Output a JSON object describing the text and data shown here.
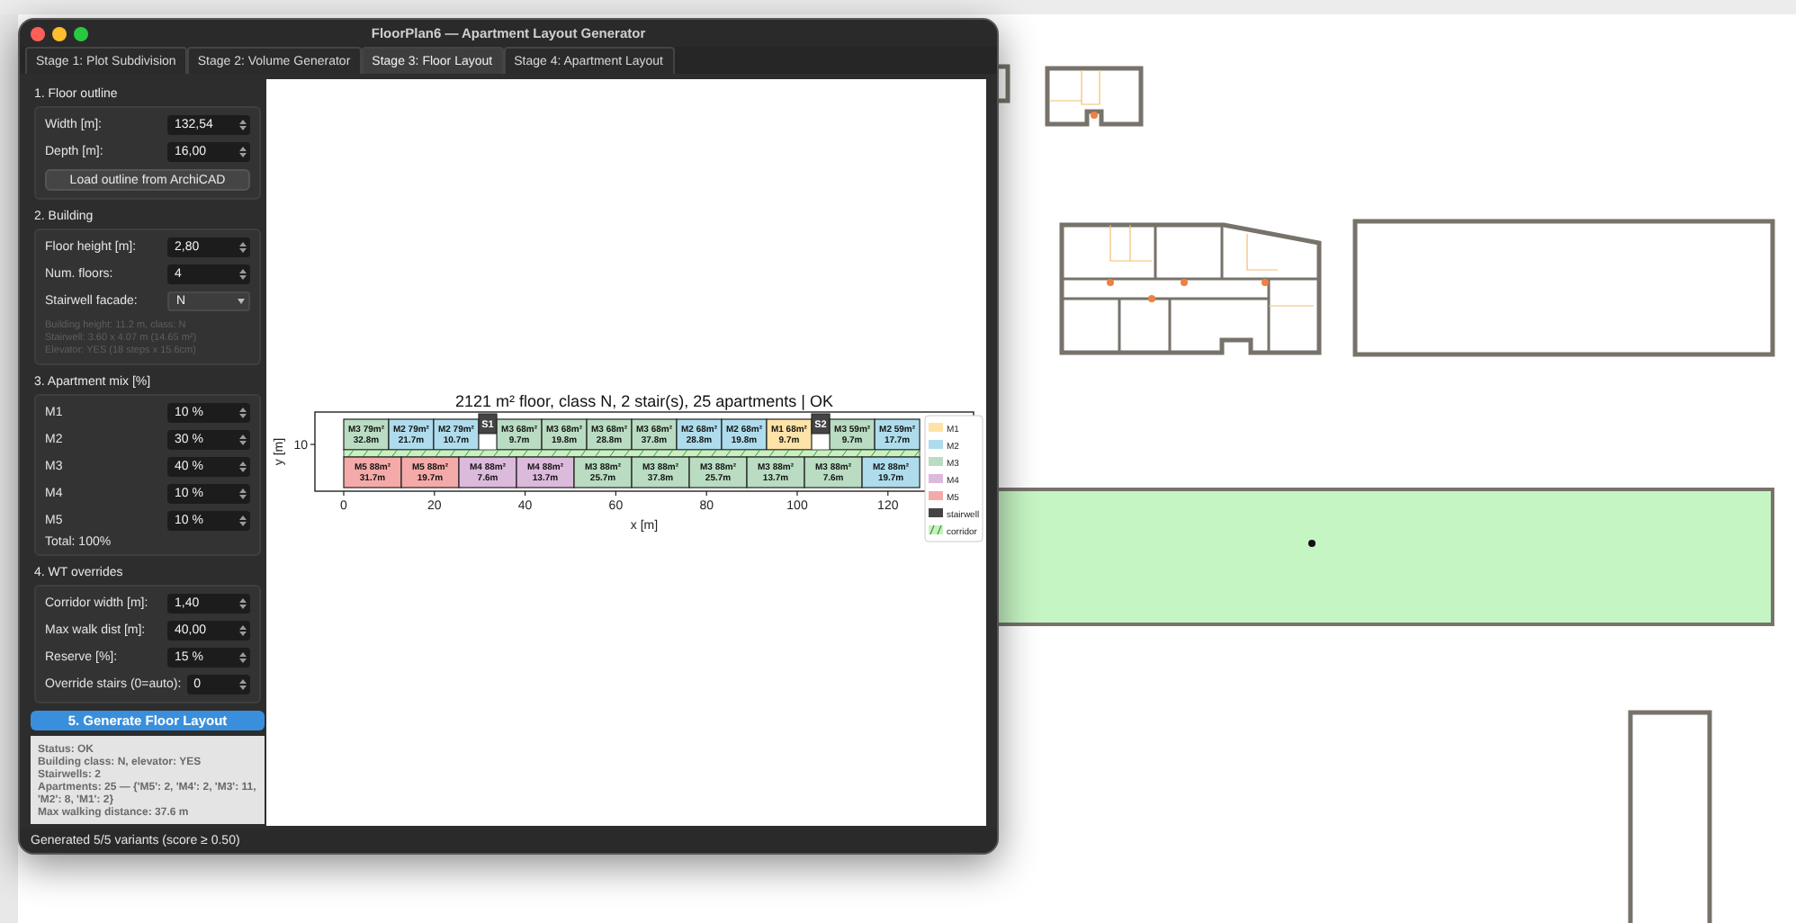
{
  "window": {
    "title": "FloorPlan6 — Apartment Layout Generator"
  },
  "tabs": [
    {
      "label": "Stage 1: Plot Subdivision",
      "selected": false
    },
    {
      "label": "Stage 2: Volume Generator",
      "selected": false
    },
    {
      "label": "Stage 3: Floor Layout",
      "selected": true
    },
    {
      "label": "Stage 4: Apartment Layout",
      "selected": false
    }
  ],
  "sections": [
    {
      "title": "1. Floor outline",
      "fields": [
        {
          "kind": "spin",
          "label": "Width [m]:",
          "value": "132,54"
        },
        {
          "kind": "spin",
          "label": "Depth [m]:",
          "value": "16,00"
        },
        {
          "kind": "button",
          "label": "Load outline from ArchiCAD"
        }
      ]
    },
    {
      "title": "2. Building",
      "fields": [
        {
          "kind": "spin",
          "label": "Floor height [m]:",
          "value": "2,80"
        },
        {
          "kind": "spin",
          "label": "Num. floors:",
          "value": "4"
        },
        {
          "kind": "combo",
          "label": "Stairwell facade:",
          "value": "N"
        },
        {
          "kind": "note",
          "lines": [
            "Building height: 11.2 m, class: N",
            "Stairwell: 3.60 x 4.07 m (14.65 m²)",
            "Elevator: YES (18 steps x 15.6cm)"
          ]
        }
      ]
    },
    {
      "title": "3. Apartment mix [%]",
      "fields": [
        {
          "kind": "spin",
          "label": "M1",
          "value": "10 %"
        },
        {
          "kind": "spin",
          "label": "M2",
          "value": "30 %"
        },
        {
          "kind": "spin",
          "label": "M3",
          "value": "40 %"
        },
        {
          "kind": "spin",
          "label": "M4",
          "value": "10 %"
        },
        {
          "kind": "spin",
          "label": "M5",
          "value": "10 %"
        },
        {
          "kind": "text",
          "label": "Total: 100%"
        }
      ]
    },
    {
      "title": "4. WT overrides",
      "fields": [
        {
          "kind": "spin",
          "label": "Corridor width [m]:",
          "value": "1,40"
        },
        {
          "kind": "spin",
          "label": "Max walk dist [m]:",
          "value": "40,00"
        },
        {
          "kind": "spin",
          "label": "Reserve [%]:",
          "value": "15 %"
        },
        {
          "kind": "spin",
          "label": "Override stairs (0=auto):",
          "value": "0"
        }
      ]
    }
  ],
  "generate_button": "5. Generate Floor Layout",
  "log": [
    "Status: OK",
    "Building class: N, elevator: YES",
    "Stairwells: 2",
    "Apartments: 25 — {'M5': 2, 'M4': 2, 'M3': 11, 'M2': 8, 'M1': 2}",
    "Max walking distance: 37.6 m"
  ],
  "status_bar": "Generated 5/5 variants (score ≥ 0.50)",
  "plot": {
    "title": "2121 m² floor, class N, 2 stair(s), 25 apartments | OK",
    "xlabel": "x [m]",
    "ylabel": "y [m]",
    "xticks": [
      "0",
      "20",
      "40",
      "60",
      "80",
      "100",
      "120"
    ],
    "yticks": [
      "10"
    ],
    "top_row": [
      {
        "kind": "apartment",
        "label": "M3 79m²",
        "distance": "32.8m",
        "color": "#b9dcc2"
      },
      {
        "kind": "apartment",
        "label": "M2 79m²",
        "distance": "21.7m",
        "color": "#aedcec"
      },
      {
        "kind": "apartment",
        "label": "M2 79m²",
        "distance": "10.7m",
        "color": "#aedcec"
      },
      {
        "kind": "stair",
        "label": "S1"
      },
      {
        "kind": "apartment",
        "label": "M3 68m²",
        "distance": "9.7m",
        "color": "#b9dcc2"
      },
      {
        "kind": "apartment",
        "label": "M3 68m²",
        "distance": "19.8m",
        "color": "#b9dcc2"
      },
      {
        "kind": "apartment",
        "label": "M3 68m²",
        "distance": "28.8m",
        "color": "#b9dcc2"
      },
      {
        "kind": "apartment",
        "label": "M3 68m²",
        "distance": "37.8m",
        "color": "#b9dcc2"
      },
      {
        "kind": "apartment",
        "label": "M2 68m²",
        "distance": "28.8m",
        "color": "#aedcec"
      },
      {
        "kind": "apartment",
        "label": "M2 68m²",
        "distance": "19.8m",
        "color": "#aedcec"
      },
      {
        "kind": "apartment",
        "label": "M1 68m²",
        "distance": "9.7m",
        "color": "#fde3a7"
      },
      {
        "kind": "stair",
        "label": "S2"
      },
      {
        "kind": "apartment",
        "label": "M3 59m²",
        "distance": "9.7m",
        "color": "#b9dcc2"
      },
      {
        "kind": "apartment",
        "label": "M2 59m²",
        "distance": "17.7m",
        "color": "#aedcec"
      }
    ],
    "bottom_row": [
      {
        "kind": "apartment",
        "label": "M5 88m²",
        "distance": "31.7m",
        "color": "#f4aaa9"
      },
      {
        "kind": "apartment",
        "label": "M5 88m²",
        "distance": "19.7m",
        "color": "#f4aaa9"
      },
      {
        "kind": "apartment",
        "label": "M4 88m²",
        "distance": "7.6m",
        "color": "#dcbadc"
      },
      {
        "kind": "apartment",
        "label": "M4 88m²",
        "distance": "13.7m",
        "color": "#dcbadc"
      },
      {
        "kind": "apartment",
        "label": "M3 88m²",
        "distance": "25.7m",
        "color": "#b9dcc2"
      },
      {
        "kind": "apartment",
        "label": "M3 88m²",
        "distance": "37.8m",
        "color": "#b9dcc2"
      },
      {
        "kind": "apartment",
        "label": "M3 88m²",
        "distance": "25.7m",
        "color": "#b9dcc2"
      },
      {
        "kind": "apartment",
        "label": "M3 88m²",
        "distance": "13.7m",
        "color": "#b9dcc2"
      },
      {
        "kind": "apartment",
        "label": "M3 88m²",
        "distance": "7.6m",
        "color": "#b9dcc2"
      },
      {
        "kind": "apartment",
        "label": "M2 88m²",
        "distance": "19.7m",
        "color": "#aedcec"
      }
    ],
    "legend": [
      {
        "kind": "fill",
        "label": "M1",
        "color": "#fde3a7"
      },
      {
        "kind": "fill",
        "label": "M2",
        "color": "#aedcec"
      },
      {
        "kind": "fill",
        "label": "M3",
        "color": "#b9dcc2"
      },
      {
        "kind": "fill",
        "label": "M4",
        "color": "#dcbadc"
      },
      {
        "kind": "fill",
        "label": "M5",
        "color": "#f4aaa9"
      },
      {
        "kind": "fill",
        "label": "stairwell",
        "color": "#444444"
      },
      {
        "kind": "hatch",
        "label": "corridor",
        "color": "#c8f0c0"
      }
    ]
  }
}
